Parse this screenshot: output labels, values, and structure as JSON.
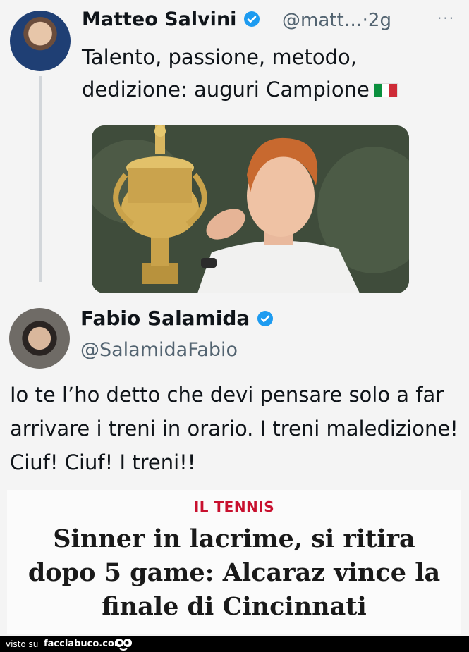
{
  "tweet1": {
    "name": "Matteo Salvini",
    "handle": "@matt…·2g",
    "more": "···",
    "text": "Talento, passione, metodo, dedizione: auguri Campione"
  },
  "tweet2": {
    "name": "Fabio Salamida",
    "handle": "@SalamidaFabio",
    "text": "Io te l’ho detto che devi pensare solo a far arrivare i treni in orario. I treni maledizione! Ciuf! Ciuf! I treni!!"
  },
  "news": {
    "section": "IL TENNIS",
    "headline": "Sinner in lacrime, si ritira dopo 5 game: Alcaraz vince la finale di Cincinnati"
  },
  "footer": {
    "visto": "visto su",
    "site": "facciabuco.com"
  },
  "colors": {
    "verified": "#1d9bf0",
    "section": "#c8102e",
    "background": "#f4f4f4"
  }
}
